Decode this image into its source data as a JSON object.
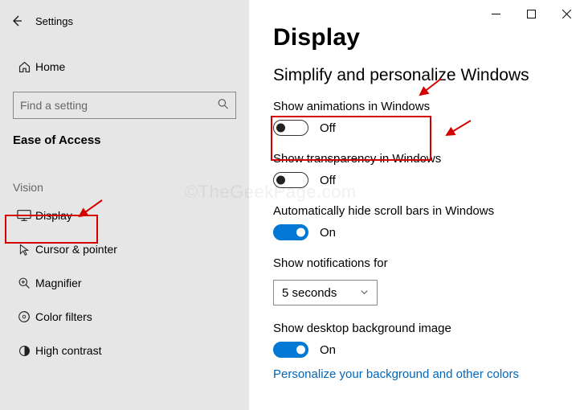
{
  "window": {
    "app_title": "Settings",
    "controls": {
      "minimize": "−",
      "maximize": "▢",
      "close": "✕"
    }
  },
  "sidebar": {
    "home_label": "Home",
    "search_placeholder": "Find a setting",
    "category_label": "Ease of Access",
    "section_label": "Vision",
    "items": [
      {
        "key": "display",
        "label": "Display",
        "active": true
      },
      {
        "key": "cursor-pointer",
        "label": "Cursor & pointer"
      },
      {
        "key": "magnifier",
        "label": "Magnifier"
      },
      {
        "key": "color-filters",
        "label": "Color filters"
      },
      {
        "key": "high-contrast",
        "label": "High contrast"
      }
    ]
  },
  "content": {
    "page_title": "Display",
    "section_heading": "Simplify and personalize Windows",
    "settings": {
      "animations": {
        "label": "Show animations in Windows",
        "state": "Off",
        "on": false
      },
      "transparency": {
        "label": "Show transparency in Windows",
        "state": "Off",
        "on": false
      },
      "autohide_scrollbars": {
        "label": "Automatically hide scroll bars in Windows",
        "state": "On",
        "on": true
      },
      "notifications": {
        "label": "Show notifications for",
        "value": "5 seconds"
      },
      "desktop_bg": {
        "label": "Show desktop background image",
        "state": "On",
        "on": true
      }
    },
    "link_personalize": "Personalize your background and other colors"
  },
  "watermark": "©TheGeekPage.com"
}
